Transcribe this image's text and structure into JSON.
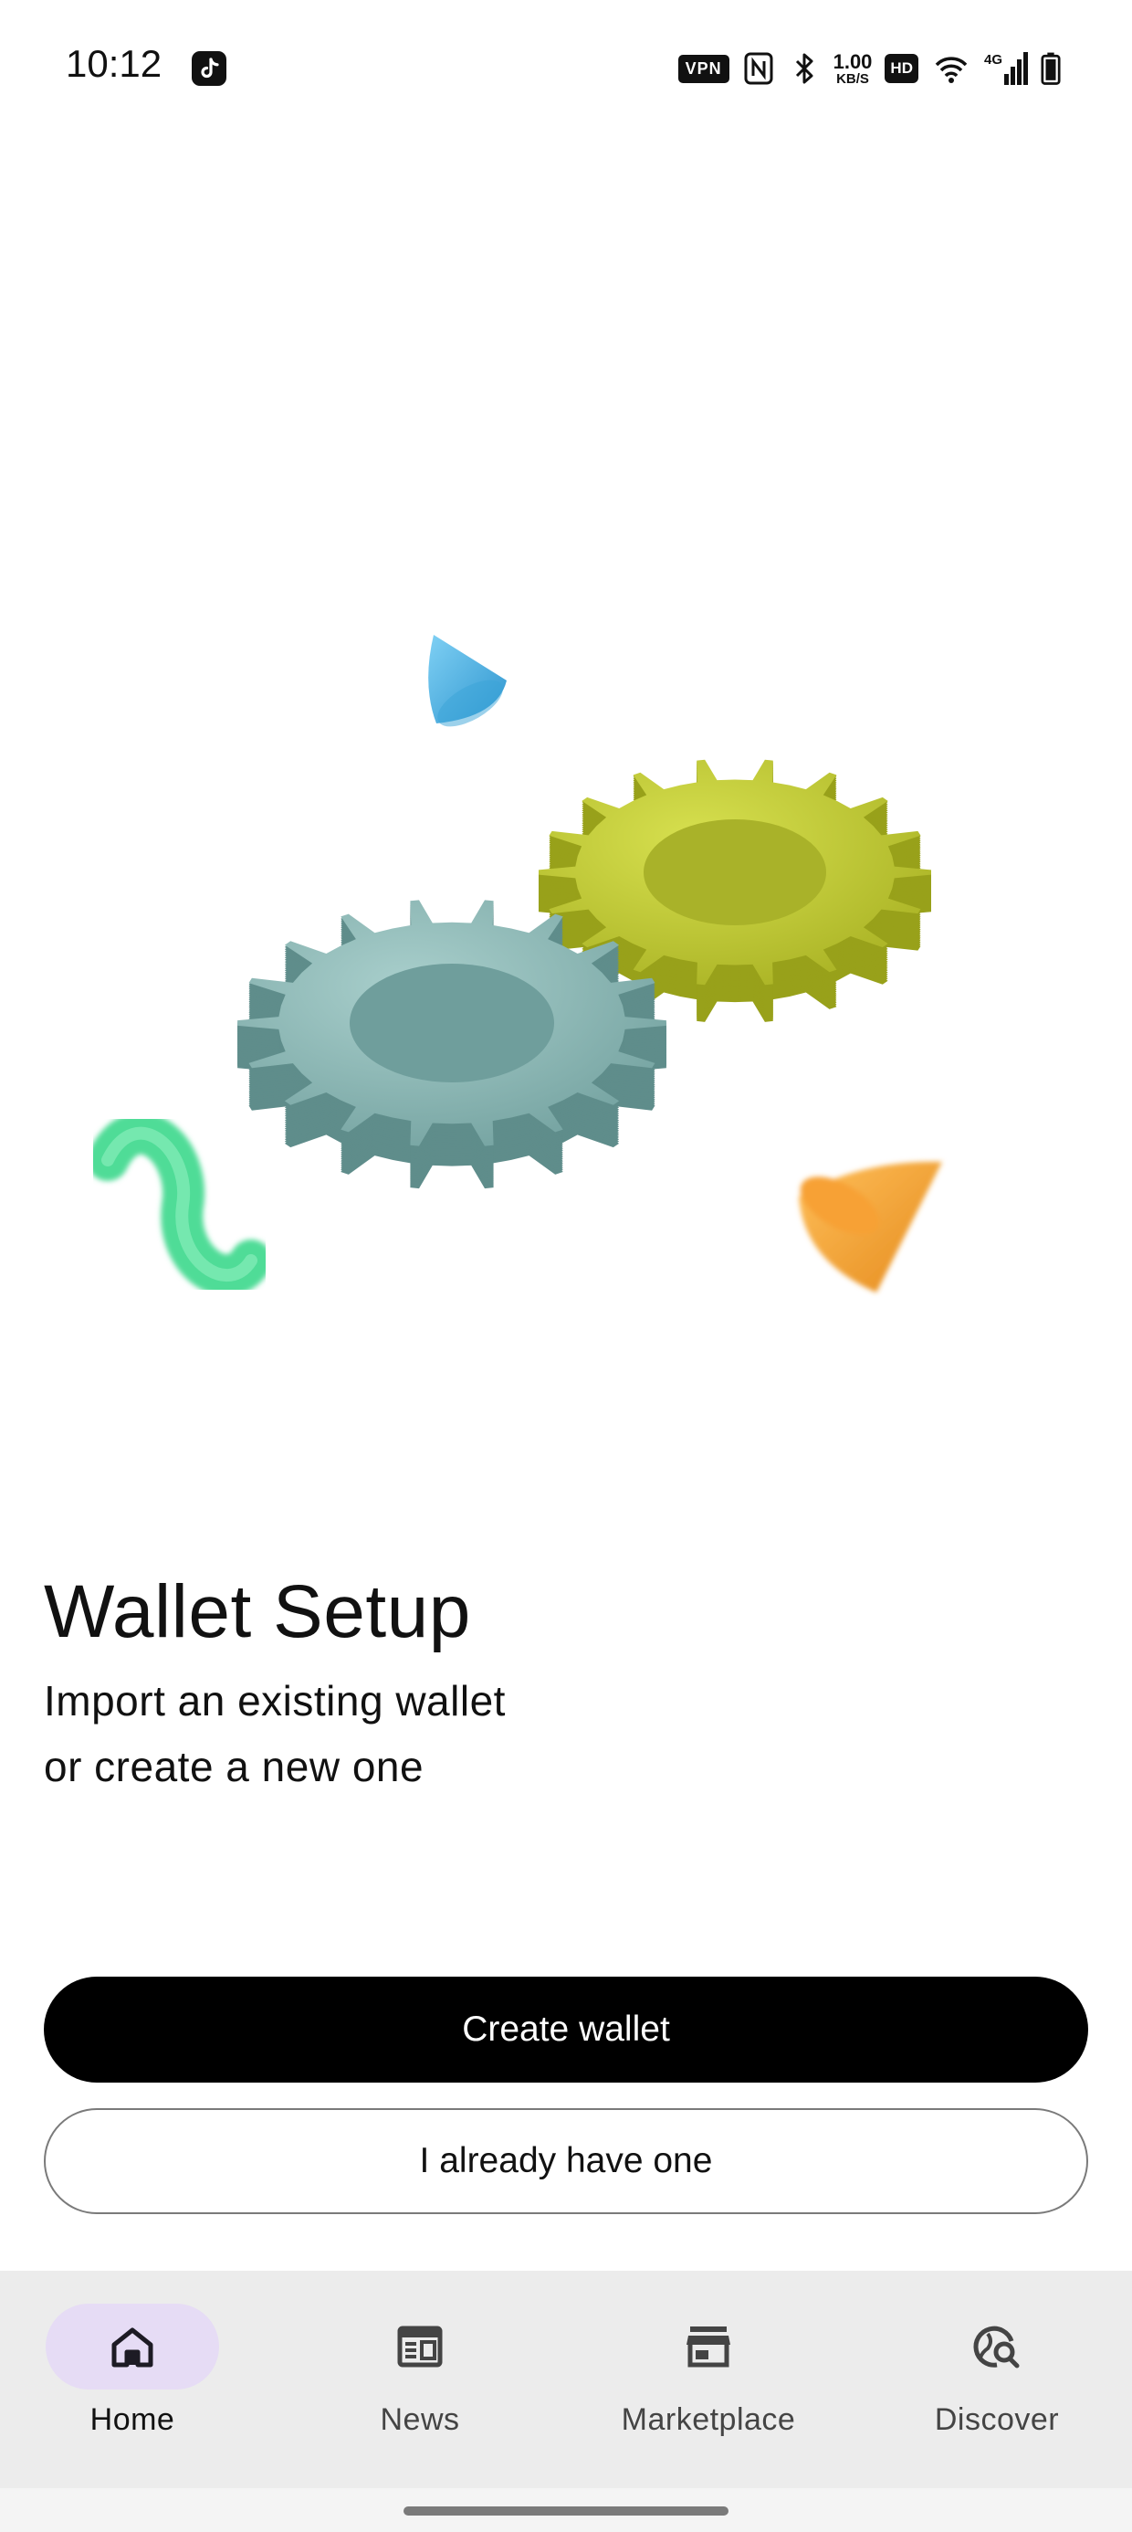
{
  "status_bar": {
    "time": "10:12",
    "vpn": "VPN",
    "speed_value": "1.00",
    "speed_unit": "KB/S",
    "hd": "HD",
    "network": "4G",
    "icons": [
      "tiktok-icon",
      "nfc-icon",
      "bluetooth-icon",
      "wifi-icon",
      "signal-icon",
      "battery-icon"
    ]
  },
  "hero": {
    "title": "Wallet Setup",
    "subtitle": "Import an existing wallet\n or create a new one"
  },
  "actions": {
    "create_label": "Create wallet",
    "import_label": "I already have one"
  },
  "bottom_nav": {
    "items": [
      {
        "label": "Home",
        "icon": "home-icon",
        "active": true
      },
      {
        "label": "News",
        "icon": "news-icon",
        "active": false
      },
      {
        "label": "Marketplace",
        "icon": "store-icon",
        "active": false
      },
      {
        "label": "Discover",
        "icon": "discover-icon",
        "active": false
      }
    ]
  },
  "colors": {
    "primary_button": "#000000",
    "nav_background": "#ececec",
    "active_pill": "#e6dcf5",
    "gear_teal": "#8fb9b7",
    "gear_lime": "#c4cf3a",
    "cone_blue": "#4fb3e6",
    "cone_orange": "#f5a53a",
    "squiggle_green": "#4fdc97"
  }
}
